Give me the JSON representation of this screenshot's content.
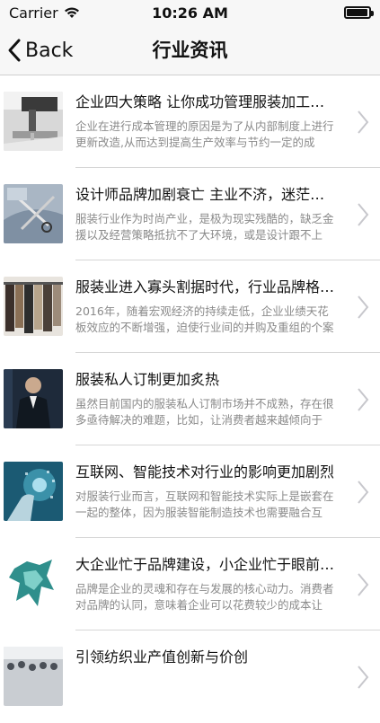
{
  "status_bar": {
    "carrier": "Carrier",
    "time": "10:26 AM",
    "battery_level": 0.95
  },
  "nav": {
    "back_label": "Back",
    "title": "行业资讯"
  },
  "articles": [
    {
      "title": "企业四大策略 让你成功管理服装加工成本",
      "summary": "企业在进行成本管理的原因是为了从内部制度上进行更新改造,从而达到提高生产效率与节约一定的成本...",
      "thumb": "sewing-machine-image"
    },
    {
      "title": "设计师品牌加剧衰亡 主业不济，迷茫中乱...",
      "summary": "服装行业作为时尚产业，是极为现实残酷的，缺乏金援以及经营策略抵抗不了大环境，或是设计跟不上时...",
      "thumb": "fabric-scissors-image"
    },
    {
      "title": "服装业进入寡头割据时代，行业品牌格局呈...",
      "summary": "2016年，随着宏观经济的持续走低，企业业绩天花板效应的不断增强，迫使行业间的并购及重组的个案及...",
      "thumb": "clothing-rack-image"
    },
    {
      "title": "服装私人订制更加炙热",
      "summary": "虽然目前国内的服装私人订制市场并不成熟，存在很多亟待解决的难题，比如，让消费者越来越倾向于接...",
      "thumb": "tailored-suit-image"
    },
    {
      "title": "互联网、智能技术对行业的影响更加剧烈",
      "summary": "对服装行业而言，互联网和智能技术实际上是嵌套在一起的整体，因为服装智能制造技术也需要融合互联...",
      "thumb": "digital-hand-image"
    },
    {
      "title": "大企业忙于品牌建设，小企业忙于眼前利益...",
      "summary": "品牌是企业的灵魂和存在与发展的核心动力。消费者对品牌的认同，意味着企业可以花费较少的成本让产...",
      "thumb": "teal-garment-image"
    },
    {
      "title": "引领纺织业产值创新与价创",
      "summary": "",
      "thumb": "crowd-expo-image"
    }
  ]
}
